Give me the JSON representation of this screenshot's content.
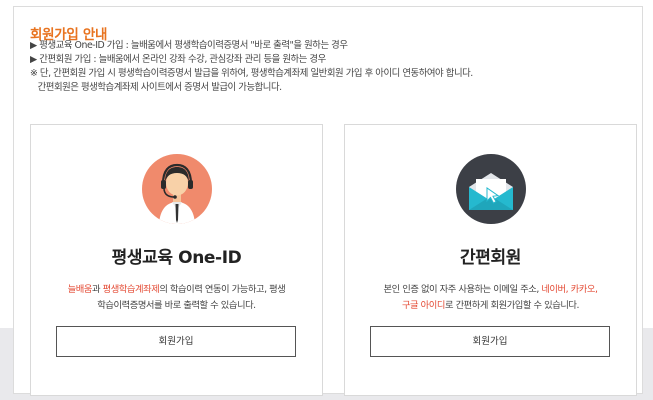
{
  "header": {
    "title": "회원가입 안내",
    "notices": [
      "▶ 평생교육 One-ID 가입 : 늘배움에서 평생학습이력증명서 \"바로 출력\"을 원하는 경우",
      "▶ 간편회원 가입 : 늘배움에서 온라인 강좌 수강, 관심강좌 관리 등을 원하는 경우",
      "※ 단, 간편회원 가입 시 평생학습이력증명서 발급을 위하여, 평생학습계좌제 일반회원 가입 후 아이디 연동하여야 합니다.",
      "   간편회원은 평생학습계좌제 사이트에서 증명서 발급이 가능합니다."
    ]
  },
  "panels": {
    "oneid": {
      "title": "평생교육 One-ID",
      "desc_hl1": "늘배움",
      "desc_t1": "과 ",
      "desc_hl2": "평생학습계좌제",
      "desc_t2": "의 학습이력 연동이 가능하고, 평생",
      "desc_line2": "학습이력증명서를 바로 출력할 수 있습니다.",
      "button": "회원가입",
      "icon": "headset-user-icon"
    },
    "simple": {
      "title": "간편회원",
      "desc_t1": "본인 인증 없이 자주 사용하는 이메일 주소, ",
      "desc_hl1": "네이버, 카카오,",
      "desc_hl2": "구글 아이디",
      "desc_t2": "로 간편하게 회원가입할 수 있습니다.",
      "button": "회원가입",
      "icon": "email-click-icon"
    }
  },
  "colors": {
    "accent": "#e8731f",
    "highlight": "#e44b35",
    "oneid_icon_bg": "#f08a6c",
    "simple_icon_bg": "#3c3f46",
    "envelope": "#25b9cf"
  }
}
